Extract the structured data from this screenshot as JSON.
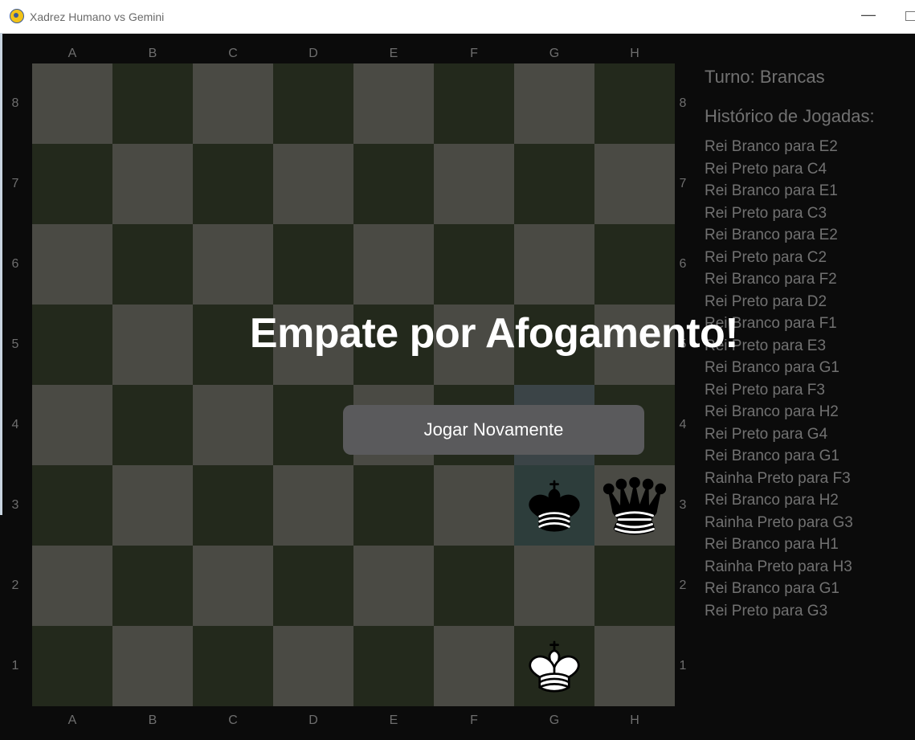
{
  "window": {
    "title": "Xadrez Humano vs Gemini",
    "icon": "pygame-snake-icon",
    "minimize_glyph": "—"
  },
  "board": {
    "files": [
      "A",
      "B",
      "C",
      "D",
      "E",
      "F",
      "G",
      "H"
    ],
    "ranks": [
      "8",
      "7",
      "6",
      "5",
      "4",
      "3",
      "2",
      "1"
    ],
    "colors": {
      "light": "#4a4a44",
      "dark": "#23291c",
      "highlight_from": "#3b4447",
      "highlight_to": "#2d3d3b"
    },
    "highlights": {
      "from": "G4",
      "to": "G3"
    },
    "pieces": [
      {
        "square": "G3",
        "type": "king",
        "color": "black"
      },
      {
        "square": "H3",
        "type": "queen",
        "color": "black"
      },
      {
        "square": "G1",
        "type": "king",
        "color": "white"
      }
    ]
  },
  "panel": {
    "turn": "Turno: Brancas",
    "history_title": "Histórico de Jogadas:",
    "history": [
      "Rei Branco para E2",
      "Rei Preto para C4",
      "Rei Branco para E1",
      "Rei Preto para C3",
      "Rei Branco para E2",
      "Rei Preto para C2",
      "Rei Branco para F2",
      "Rei Preto para D2",
      "Rei Branco para F1",
      "Rei Preto para E3",
      "Rei Branco para G1",
      "Rei Preto para F3",
      "Rei Branco para H2",
      "Rei Preto para G4",
      "Rei Branco para G1",
      "Rainha Preto para F3",
      "Rei Branco para H2",
      "Rainha Preto para G3",
      "Rei Branco para H1",
      "Rainha Preto para H3",
      "Rei Branco para G1",
      "Rei Preto para G3"
    ]
  },
  "overlay": {
    "message": "Empate por Afogamento!",
    "button_label": "Jogar Novamente"
  }
}
